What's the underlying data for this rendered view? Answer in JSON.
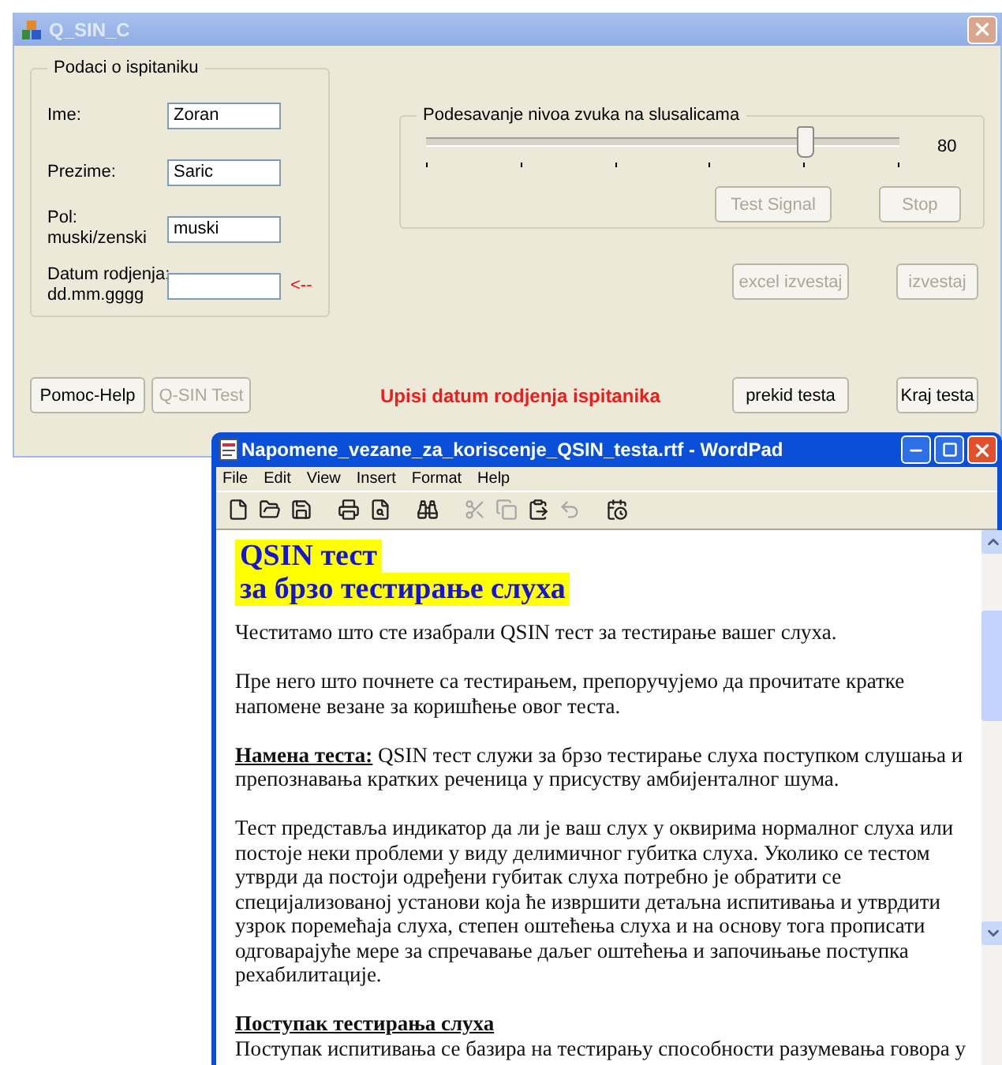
{
  "main_window": {
    "title": "Q_SIN_C",
    "group_title": "Podaci o ispitaniku",
    "fields": [
      {
        "label": "Ime:",
        "value": "Zoran"
      },
      {
        "label": "Prezime:",
        "value": "Saric"
      },
      {
        "label": "Pol:\nmuski/zenski",
        "value": "muski"
      },
      {
        "label": "Datum rodjenja:\ndd.mm.gggg",
        "pointer": "<--"
      }
    ],
    "volume": {
      "title": "Podesavanje nivoa zvuka na slusalicama",
      "level": 0.8,
      "reading": "80",
      "buttons": [
        {
          "label": "Test Signal",
          "disabled": true
        },
        {
          "label": "Stop",
          "disabled": true
        }
      ]
    },
    "report_buttons": [
      {
        "label": "excel izvestaj",
        "disabled": true
      },
      {
        "label": "izvestaj",
        "disabled": true
      }
    ],
    "bottom_left_buttons": [
      {
        "label": "Pomoc-Help",
        "disabled": false
      },
      {
        "label": "Q-SIN Test",
        "disabled": true
      }
    ],
    "message": "Upisi datum rodjenja ispitanika",
    "bottom_right_buttons": [
      {
        "label": "prekid testa",
        "disabled": false
      },
      {
        "label": "Kraj testa",
        "disabled": false
      }
    ]
  },
  "wordpad": {
    "title": "Napomene_vezane_za_koriscenje_QSIN_testa.rtf - WordPad",
    "menu": [
      "File",
      "Edit",
      "View",
      "Insert",
      "Format",
      "Help"
    ],
    "toolbar": [
      {
        "kind": "new",
        "disabled": false
      },
      {
        "kind": "open",
        "disabled": false
      },
      {
        "kind": "save",
        "disabled": false
      },
      {
        "kind": "sep"
      },
      {
        "kind": "print",
        "disabled": false
      },
      {
        "kind": "preview",
        "disabled": false
      },
      {
        "kind": "sep"
      },
      {
        "kind": "find",
        "disabled": false
      },
      {
        "kind": "sep"
      },
      {
        "kind": "cut",
        "disabled": true
      },
      {
        "kind": "copy",
        "disabled": true
      },
      {
        "kind": "paste",
        "disabled": false
      },
      {
        "kind": "undo",
        "disabled": true
      },
      {
        "kind": "sep"
      },
      {
        "kind": "datetime",
        "disabled": false
      }
    ],
    "document": [
      {
        "kind": "title",
        "text": "QSIN тест"
      },
      {
        "kind": "title",
        "text": "за брзо тестирање слуха"
      },
      {
        "kind": "plain",
        "text": "Честитамо што сте изабрали QSIN тест за тестирање вашег слуха."
      },
      {
        "kind": "plain",
        "text": "Пре него што почнете са тестирањем, препоручујемо да прочитате кратке напомене везане за коришћење овог теста."
      },
      {
        "kind": "lead",
        "lead": "Намена теста:",
        "text": "QSIN тест служи за брзо тестирање слуха поступком слушања и препознавања кратких реченица у присуству амбијенталног шума."
      },
      {
        "kind": "plain",
        "text": "Тест представља индикатор да ли је ваш слух у оквирима нормалног слуха или постоје неки проблеми у виду делимичног губитка слуха. Уколико се тестом утврди да постоји одређени губитак слуха потребно је обратити се специјализованој установи која ће извршити детаљна испитивања и утврдити узрок поремећаја слуха, степен оштећења слуха и на основу тога прописати одговарајуће мере за спречавање даљег оштећења и започињање поступка рехабилитације."
      },
      {
        "kind": "heading",
        "text": "Поступак тестирања слуха"
      },
      {
        "kind": "tail",
        "text": "Поступак испитивања се базира на тестирању способности разумевања говора у"
      }
    ]
  }
}
